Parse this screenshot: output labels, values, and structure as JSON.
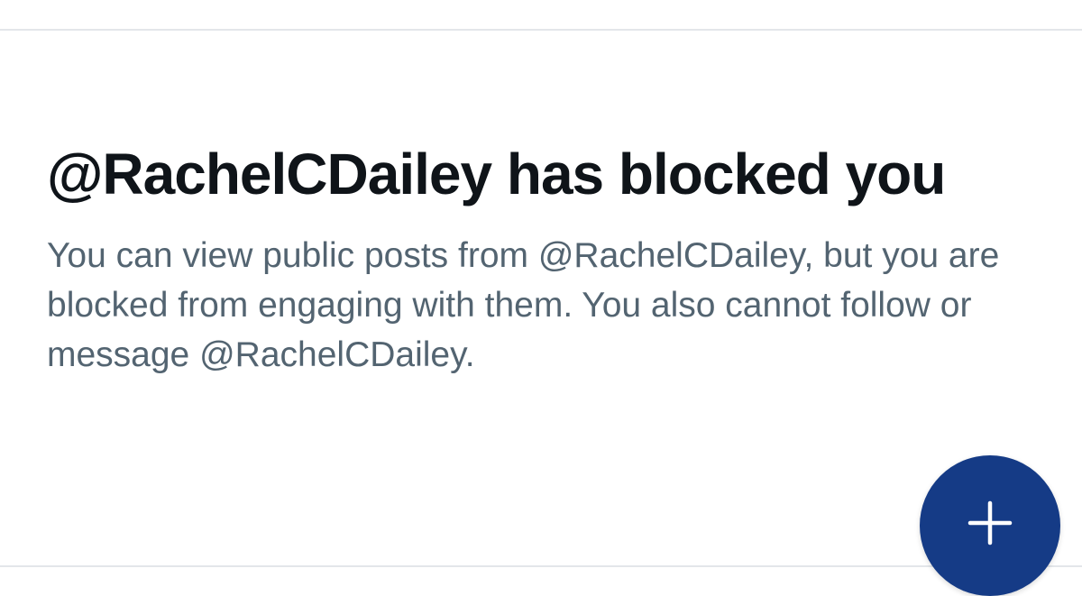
{
  "blocked_notice": {
    "title": "@RachelCDailey has blocked you",
    "description": "You can view public posts from @RachelCDailey, but you are blocked from engaging with them. You also cannot follow or message @RachelCDailey."
  },
  "fab": {
    "icon": "plus-icon",
    "color": "#153b86"
  }
}
